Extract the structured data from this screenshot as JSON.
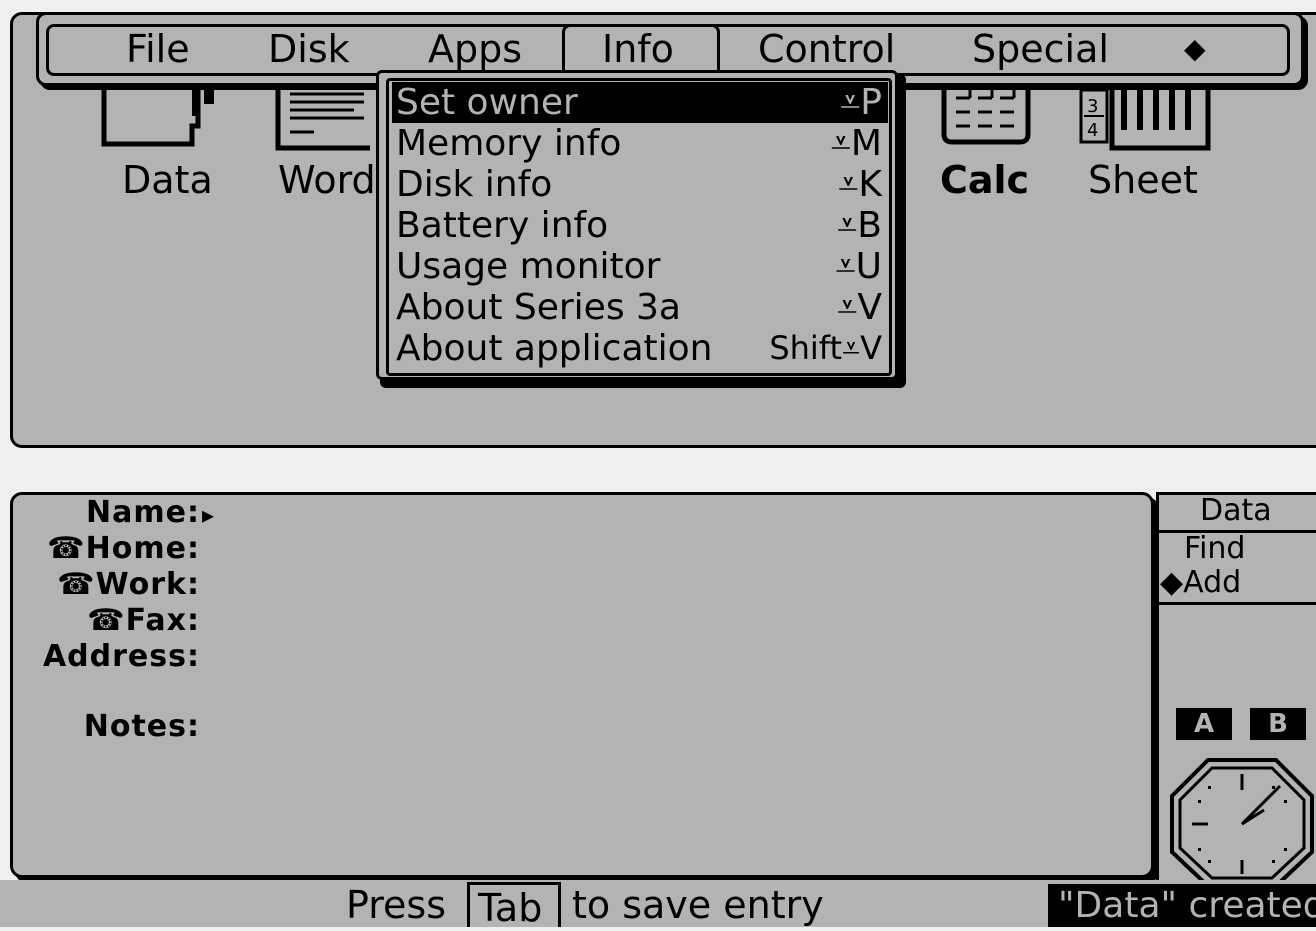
{
  "menubar": {
    "titles": [
      "File",
      "Disk",
      "Apps",
      "Info",
      "Control",
      "Special",
      "◆"
    ],
    "active": "Info"
  },
  "apps": [
    {
      "label": "Data",
      "icon": "data-app-icon"
    },
    {
      "label": "Word",
      "icon": "word-app-icon"
    },
    {
      "label": "Calc",
      "icon": "calc-app-icon"
    },
    {
      "label": "Sheet",
      "icon": "sheet-app-icon"
    }
  ],
  "info_menu": {
    "items": [
      {
        "label": "Set owner",
        "shortcut": "⩡P",
        "selected": true
      },
      {
        "label": "Memory info",
        "shortcut": "⩡M"
      },
      {
        "label": "Disk info",
        "shortcut": "⩡K"
      },
      {
        "label": "Battery info",
        "shortcut": "⩡B"
      },
      {
        "label": "Usage monitor",
        "shortcut": "⩡U"
      },
      {
        "label": "About Series 3a",
        "shortcut": "⩡V"
      },
      {
        "label": "About application",
        "shortcut": "Shift⩡V"
      }
    ]
  },
  "form": {
    "fields": [
      {
        "label": "Name:",
        "cursor": "▸"
      },
      {
        "label": "☎Home:"
      },
      {
        "label": "☎Work:"
      },
      {
        "label": "☎Fax:"
      },
      {
        "label": "Address:"
      },
      {
        "label": "Notes:"
      }
    ]
  },
  "side_panel": {
    "title": "Data",
    "modes": [
      "Find",
      "◆Add"
    ],
    "drives": [
      "A",
      "B"
    ],
    "clock_icon": "analog-clock-icon"
  },
  "status": {
    "press": "Press",
    "key": "Tab",
    "rest": "to save entry",
    "message": "\"Data\" created"
  },
  "colors": {
    "screen": "#b3b3b3",
    "ink": "#000000",
    "background": "#efefee"
  }
}
